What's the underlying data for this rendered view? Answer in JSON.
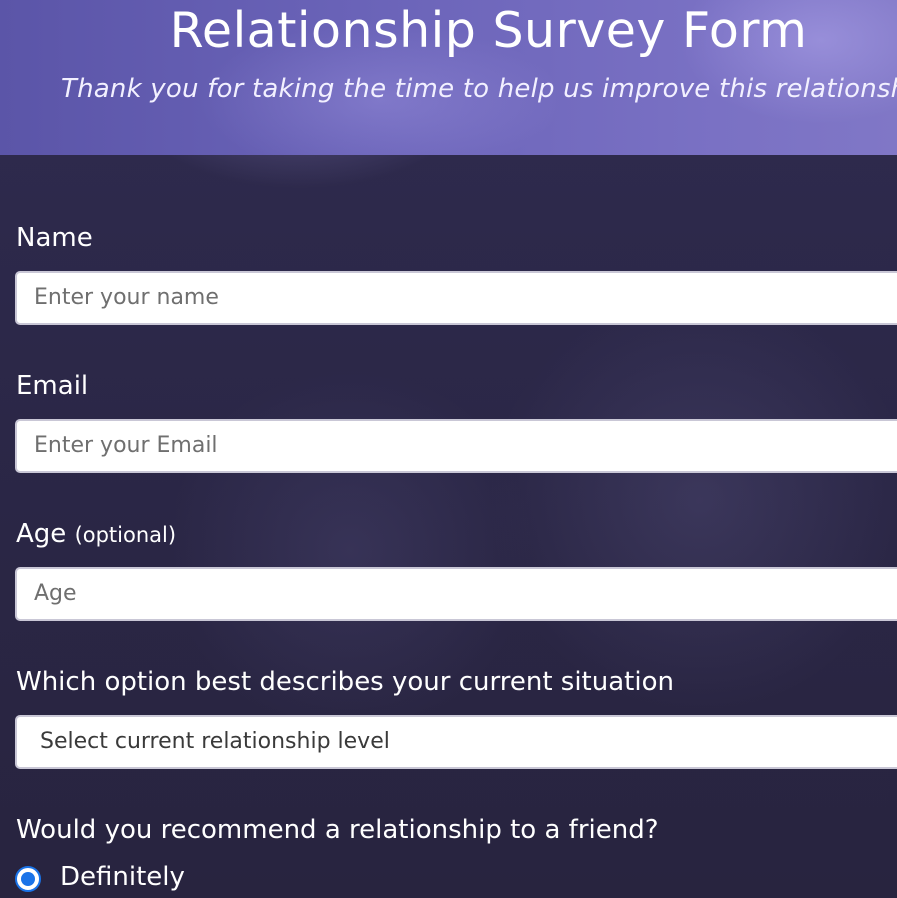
{
  "header": {
    "title": "Relationship Survey Form",
    "subtitle": "Thank you for taking the time to help us improve this relationship"
  },
  "form": {
    "name": {
      "label": "Name",
      "placeholder": "Enter your name"
    },
    "email": {
      "label": "Email",
      "placeholder": "Enter your Email"
    },
    "age": {
      "label": "Age",
      "optional": "(optional)",
      "placeholder": "Age"
    },
    "situation": {
      "label": "Which option best describes your current situation",
      "selected": "Select current relationship level"
    },
    "recommend": {
      "label": "Would you recommend a relationship to a friend?",
      "options": [
        {
          "label": "Definitely",
          "checked": true
        }
      ]
    }
  },
  "colors": {
    "header_bg": "#6a63b8",
    "page_bg": "#2b2748",
    "radio_accent": "#1a73e8"
  }
}
